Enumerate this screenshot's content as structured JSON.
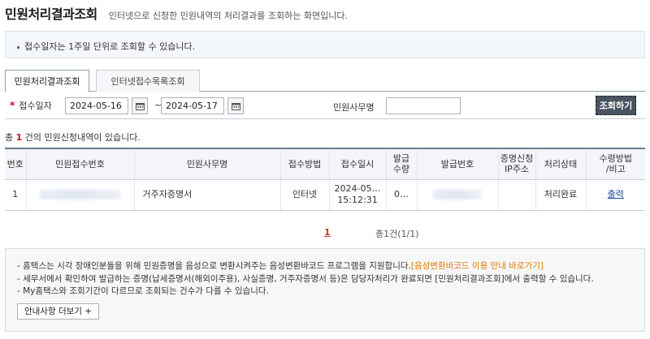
{
  "header": {
    "title": "민원처리결과조회",
    "description": "인터넷으로 신청한 민원내역의 처리결과를 조회하는 화면입니다."
  },
  "notice": {
    "text": "접수일자는 1주일 단위로 조회할 수 있습니다."
  },
  "tabs": [
    {
      "label": "민원처리결과조회",
      "active": true
    },
    {
      "label": "인터넷접수목록조회",
      "active": false
    }
  ],
  "search": {
    "required_mark": "*",
    "date_label": "접수일자",
    "date_from": "2024-05-16",
    "date_to": "2024-05-17",
    "tilde": "~",
    "office_label": "민원사무명",
    "office_value": "",
    "button_label": "조회하기"
  },
  "summary": {
    "prefix": "총 ",
    "count": "1",
    "suffix": " 건의 민원신청내역이 있습니다."
  },
  "table": {
    "headers": [
      "번호",
      "민원접수번호",
      "민원사무명",
      "접수방법",
      "접수일시",
      "발급\n수량",
      "발급번호",
      "증명신청\nIP주소",
      "처리상태",
      "수령방법\n/비고"
    ],
    "rows": [
      {
        "no": "1",
        "receipt_no": "",
        "office_name": "거주자증명서",
        "method": "인터넷",
        "date_line1": "2024-05…",
        "date_line2": "15:12:31",
        "qty": "0…",
        "issue_no": "",
        "ip": "",
        "status": "처리완료",
        "action": "출력"
      }
    ]
  },
  "pagination": {
    "current": "1",
    "total_text": "총1건(1/1)"
  },
  "guide": {
    "line1_text": "- 홈택스는 시각 장애인분들을 위해 민원증명을 음성으로 변환시켜주는 음성변환바코드 프로그램을 지원합니다.",
    "line1_link": "[음성변환바코드 이용 안내 바로가기]",
    "line2": "- 세무서에서 확인하여 발급하는 증명(납세증명서(해외이주용), 사실증명, 거주자증명서 등)은 담당자처리가 완료되면 [민원처리결과조회]에서 출력할 수 있습니다.",
    "line3": "- My홈택스와 조회기간이 다르므로 조회되는 건수가 다를 수 있습니다.",
    "button_label": "안내사항 더보기 +"
  }
}
